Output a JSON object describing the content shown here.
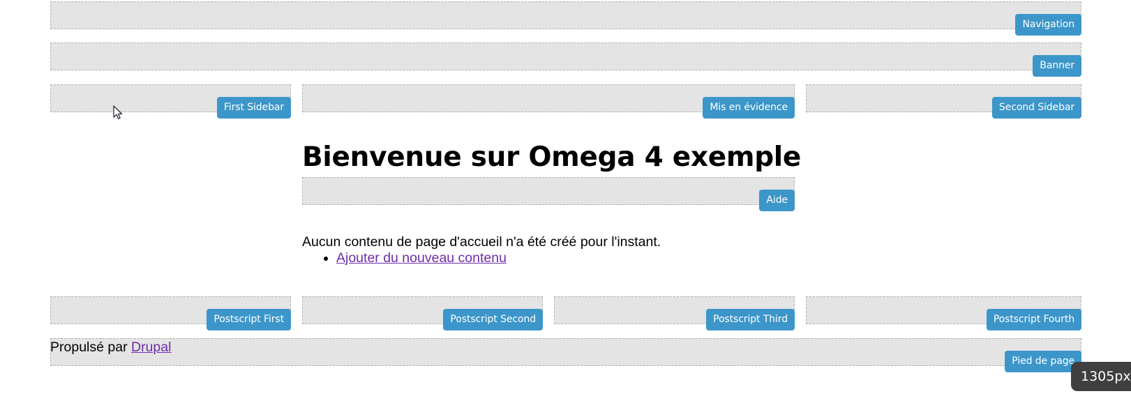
{
  "theme": {
    "badge_color": "#3c96c9",
    "badge_text_color": "#ffffff",
    "region_fill": "#e4e4e4",
    "region_border": "#b3b3b3",
    "link_color": "#6f2da8",
    "indicator_bg": "#3f3f3f"
  },
  "regions": {
    "navigation": {
      "label": "Navigation"
    },
    "banner": {
      "label": "Banner"
    },
    "first_sidebar": {
      "label": "First Sidebar"
    },
    "highlighted": {
      "label": "Mis en évidence"
    },
    "second_sidebar": {
      "label": "Second Sidebar"
    },
    "help": {
      "label": "Aide"
    },
    "postscript_first": {
      "label": "Postscript First"
    },
    "postscript_second": {
      "label": "Postscript Second"
    },
    "postscript_third": {
      "label": "Postscript Third"
    },
    "postscript_fourth": {
      "label": "Postscript Fourth"
    },
    "footer": {
      "label": "Pied de page"
    }
  },
  "main": {
    "page_title": "Bienvenue sur Omega 4 exemple",
    "empty_message": "Aucun contenu de page d'accueil n'a été créé pour l'instant.",
    "actions": [
      {
        "label": "Ajouter du nouveau contenu"
      }
    ]
  },
  "footer": {
    "powered_by_prefix": "Propulsé par ",
    "powered_by_link": "Drupal"
  },
  "viewport_indicator": {
    "value": "1305px"
  }
}
